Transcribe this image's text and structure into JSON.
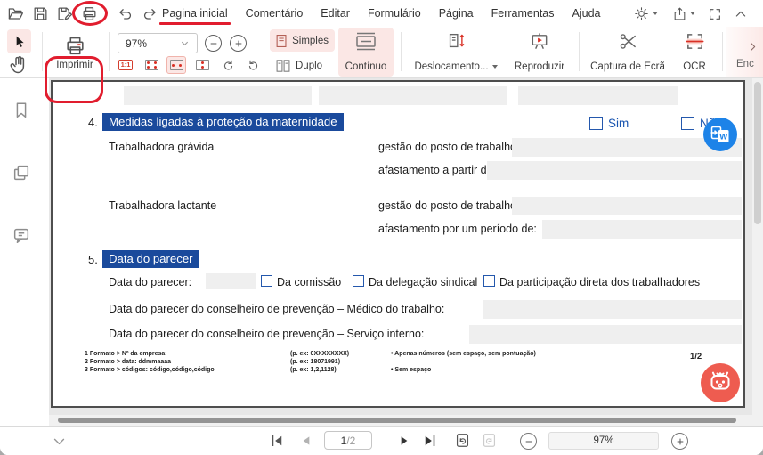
{
  "colors": {
    "annotation_red": "#e11d2e",
    "accent_red": "#d93025",
    "selected_pink": "#fbe7e5",
    "heading_blue": "#1a4a9c",
    "form_blue": "#1a55b0",
    "field_gray": "#efefef",
    "convert_blue": "#1d83e8",
    "mascot_coral": "#ee5c50"
  },
  "menubar": {
    "tabs": [
      "Pagina inicial",
      "Comentário",
      "Editar",
      "Formulário",
      "Página",
      "Ferramentas",
      "Ajuda"
    ]
  },
  "toolbar": {
    "print_label": "Imprimir",
    "zoom_value": "97%",
    "one_to_one": "1:1",
    "single_label": "Simples",
    "double_label": "Duplo",
    "continuous_label": "Contínuo",
    "scroll_label": "Deslocamento...",
    "play_label": "Reproduzir",
    "screenshot_label": "Captura de Ecrã",
    "ocr_label": "OCR",
    "overflow_label": "Enc"
  },
  "document": {
    "section4": {
      "number": "4.",
      "title": "Medidas ligadas à proteção da maternidade",
      "yes_label": "Sim",
      "no_label": "Não",
      "rows": [
        {
          "label": "Trabalhadora grávida",
          "line1": "gestão do posto de trabalho:",
          "line2": "afastamento a partir de:"
        },
        {
          "label": "Trabalhadora lactante",
          "line1": "gestão do posto de trabalho:",
          "line2": "afastamento por um período de:"
        }
      ]
    },
    "section5": {
      "number": "5.",
      "title": "Data do parecer",
      "date_label": "Data do parecer:",
      "checkbox_labels": [
        "Da comissão",
        "Da delegação sindical",
        "Da participação direta dos trabalhadores"
      ],
      "row_medico": "Data do parecer do conselheiro de prevenção – Médico do trabalho:",
      "row_servico": "Data do parecer do conselheiro de prevenção – Serviço interno:"
    },
    "footnotes": [
      {
        "c1": "1 Formato > Nº da empresa:",
        "c2": "(p. ex: 0XXXXXXXX)",
        "c3": "•   Apenas números (sem espaço, sem pontuação)"
      },
      {
        "c1": "2 Formato > data: ddmmaaaa",
        "c2": "(p. ex: 18071991)",
        "c3": ""
      },
      {
        "c1": "3 Formato > códigos: código,código,código",
        "c2": "(p. ex: 1,2,1128)",
        "c3": "•   Sem espaço"
      }
    ],
    "page_fraction": "1/2"
  },
  "statusbar": {
    "page_current": "1",
    "page_total": "/2",
    "zoom_value": "97%"
  },
  "icons": {
    "menubar": [
      "open-folder-icon",
      "save-icon",
      "save-as-icon",
      "print-icon",
      "undo-icon",
      "redo-icon",
      "theme-icon",
      "share-icon",
      "fullscreen-icon",
      "collapse-toolbar-icon"
    ],
    "toolbar": [
      "select-cursor-icon",
      "hand-tool-icon",
      "printer-icon",
      "zoom-out-icon",
      "zoom-in-icon",
      "one-to-one-icon",
      "fit-page-icon",
      "fit-width-icon",
      "fit-height-icon",
      "rotate-cw-icon",
      "rotate-ccw-icon",
      "single-page-icon",
      "double-page-icon",
      "continuous-icon",
      "scrolling-icon",
      "presentation-icon",
      "scissors-icon",
      "ocr-icon",
      "overflow-chevron-icon"
    ],
    "sidebar": [
      "bookmark-icon",
      "thumbnails-icon",
      "comment-icon"
    ],
    "statusbar": [
      "collapse-icon",
      "first-page-icon",
      "prev-page-icon",
      "next-page-icon",
      "last-page-icon",
      "previous-view-icon",
      "next-view-icon",
      "zoom-out-icon",
      "zoom-in-icon"
    ],
    "floating": [
      "pdf-to-word-icon",
      "assistant-mascot-icon"
    ]
  }
}
